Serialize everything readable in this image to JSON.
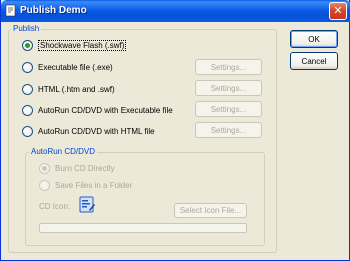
{
  "window": {
    "title": "Publish Demo",
    "close_glyph": "✕"
  },
  "publish": {
    "label": "Publish",
    "options": [
      {
        "label": "Shockwave Flash (.swf)",
        "checked": true
      },
      {
        "label": "Executable file (.exe)",
        "checked": false,
        "settings": "Settings..."
      },
      {
        "label": "HTML (.htm and .swf)",
        "checked": false,
        "settings": "Settings..."
      },
      {
        "label": "AutoRun CD/DVD with Executable file",
        "checked": false,
        "settings": "Settings..."
      },
      {
        "label": "AutoRun CD/DVD with HTML file",
        "checked": false,
        "settings": "Settings..."
      }
    ]
  },
  "autorun": {
    "label": "AutoRun CD/DVD",
    "burn_label": "Burn CD Directly",
    "save_label": "Save Files in a Folder",
    "cd_icon_label": "CD Icon:",
    "select_icon_button": "Select Icon File...",
    "path_value": ""
  },
  "buttons": {
    "ok": "OK",
    "cancel": "Cancel"
  },
  "icons": {
    "app": "app-icon",
    "cd": "cd-icon",
    "close": "close-icon"
  }
}
